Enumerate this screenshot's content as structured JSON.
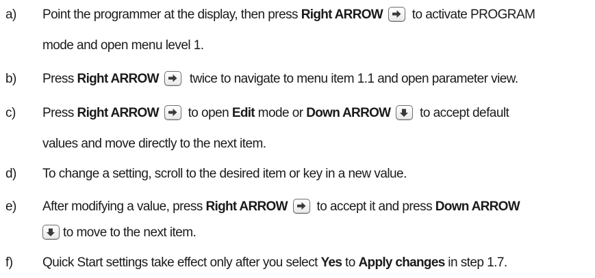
{
  "steps": [
    {
      "marker": "a)",
      "line1": {
        "t1": "Point the programmer at the display, then press ",
        "b1": "Right ARROW",
        "t2": " to activate PROGRAM"
      },
      "line2": "mode and open menu level 1."
    },
    {
      "marker": "b)",
      "t1": "Press ",
      "b1": "Right ARROW",
      "t2": "twice to navigate to menu item 1.1 and open parameter view."
    },
    {
      "marker": "c)",
      "line1": {
        "t1": "Press ",
        "b1": "Right ARROW",
        "t2": " to open ",
        "b2": "Edit",
        "t3": " mode or ",
        "b3": "Down ARROW",
        "t4": " to accept default"
      },
      "line2": "values and move directly to the next item."
    },
    {
      "marker": "d)",
      "text": "To change a setting, scroll to the desired item or key in a new value."
    },
    {
      "marker": "e)",
      "line1": {
        "t1": "After modifying a value, press ",
        "b1": "Right ARROW",
        "t2": " to accept it and press ",
        "b2": "Down ARROW"
      },
      "line2": "to move to the next item."
    },
    {
      "marker": "f)",
      "t1": "Quick Start settings take effect only after you select ",
      "b1": "Yes",
      "t2": " to ",
      "b2": "Apply changes",
      "t3": " in step 1.7."
    }
  ],
  "icons": {
    "right_key": "right-arrow-key-icon",
    "down_key": "down-arrow-key-icon"
  },
  "colors": {
    "text": "#1a1a1a",
    "key_border": "#6d6d6d"
  }
}
